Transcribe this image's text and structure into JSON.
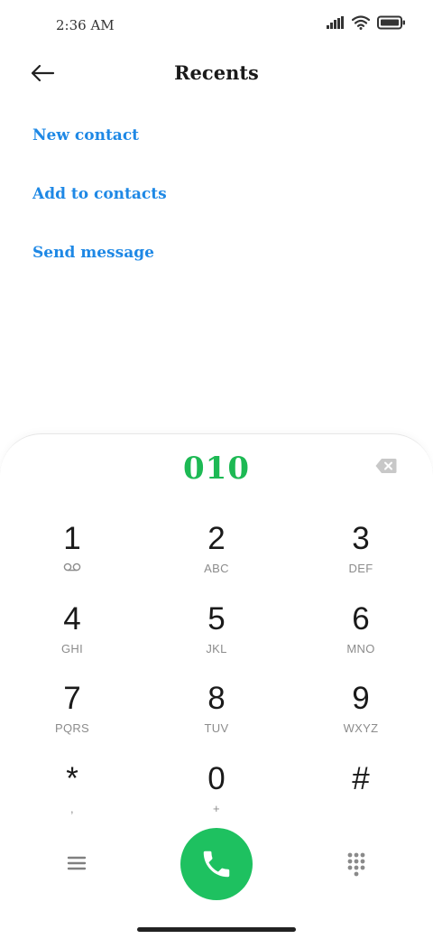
{
  "status_bar": {
    "time": "2:36 AM",
    "icons": [
      "signal-icon",
      "wifi-icon",
      "battery-icon"
    ]
  },
  "header": {
    "title": "Recents",
    "back_icon": "arrow-left-icon"
  },
  "actions": {
    "new_contact": "New contact",
    "add_to_contacts": "Add to contacts",
    "send_message": "Send message"
  },
  "dialer": {
    "number": "010",
    "backspace_icon": "backspace-icon",
    "keys": [
      {
        "digit": "1",
        "letters": ""
      },
      {
        "digit": "2",
        "letters": "ABC"
      },
      {
        "digit": "3",
        "letters": "DEF"
      },
      {
        "digit": "4",
        "letters": "GHI"
      },
      {
        "digit": "5",
        "letters": "JKL"
      },
      {
        "digit": "6",
        "letters": "MNO"
      },
      {
        "digit": "7",
        "letters": "PQRS"
      },
      {
        "digit": "8",
        "letters": "TUV"
      },
      {
        "digit": "9",
        "letters": "WXYZ"
      },
      {
        "digit": "*",
        "letters": ","
      },
      {
        "digit": "0",
        "letters": "+"
      },
      {
        "digit": "#",
        "letters": ""
      }
    ],
    "menu_icon": "menu-icon",
    "call_icon": "phone-icon",
    "dialpad_icon": "dialpad-icon"
  },
  "colors": {
    "accent_blue": "#1e88e5",
    "number_green": "#1db954",
    "call_green": "#1ec160",
    "letters_gray": "#8c8c8c"
  }
}
